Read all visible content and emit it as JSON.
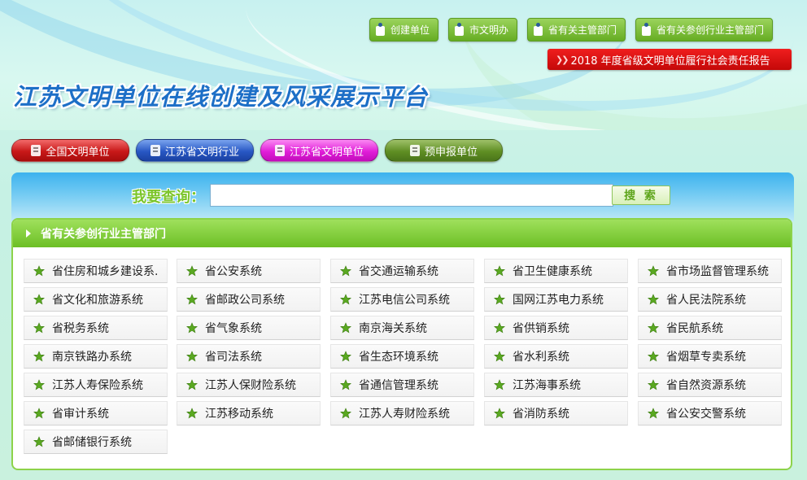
{
  "header": {
    "top_links": [
      {
        "label": "创建单位",
        "icon": "document-icon"
      },
      {
        "label": "市文明办",
        "icon": "document-icon"
      },
      {
        "label": "省有关主管部门",
        "icon": "document-icon"
      },
      {
        "label": "省有关参创行业主管部门",
        "icon": "document-icon"
      }
    ],
    "report_link": "2018 年度省级文明单位履行社会责任报告",
    "site_title": "江苏文明单位在线创建及风采展示平台"
  },
  "categories": [
    {
      "label": "全国文明单位",
      "color": "#c81818"
    },
    {
      "label": "江苏省文明行业",
      "color": "#2857c4"
    },
    {
      "label": "江苏省文明单位",
      "color": "#e01ed8"
    },
    {
      "label": "预申报单位",
      "color": "#5f8e23"
    }
  ],
  "search": {
    "label": "我要查询：",
    "value": "",
    "placeholder": "",
    "button": "搜 索"
  },
  "panel": {
    "title": "省有关参创行业主管部门",
    "items": [
      "省住房和城乡建设系.",
      "省公安系统",
      "省交通运输系统",
      "省卫生健康系统",
      "省市场监督管理系统",
      "省文化和旅游系统",
      "省邮政公司系统",
      "江苏电信公司系统",
      "国网江苏电力系统",
      "省人民法院系统",
      "省税务系统",
      "省气象系统",
      "南京海关系统",
      "省供销系统",
      "省民航系统",
      "南京铁路办系统",
      "省司法系统",
      "省生态环境系统",
      "省水利系统",
      "省烟草专卖系统",
      "江苏人寿保险系统",
      "江苏人保财险系统",
      "省通信管理系统",
      "江苏海事系统",
      "省自然资源系统",
      "省审计系统",
      "江苏移动系统",
      "江苏人寿财险系统",
      "省消防系统",
      "省公安交警系统",
      "省邮储银行系统"
    ]
  },
  "colors": {
    "accent_green": "#6cbf25",
    "title_blue": "#1d6fc7",
    "report_red": "#d01010"
  }
}
